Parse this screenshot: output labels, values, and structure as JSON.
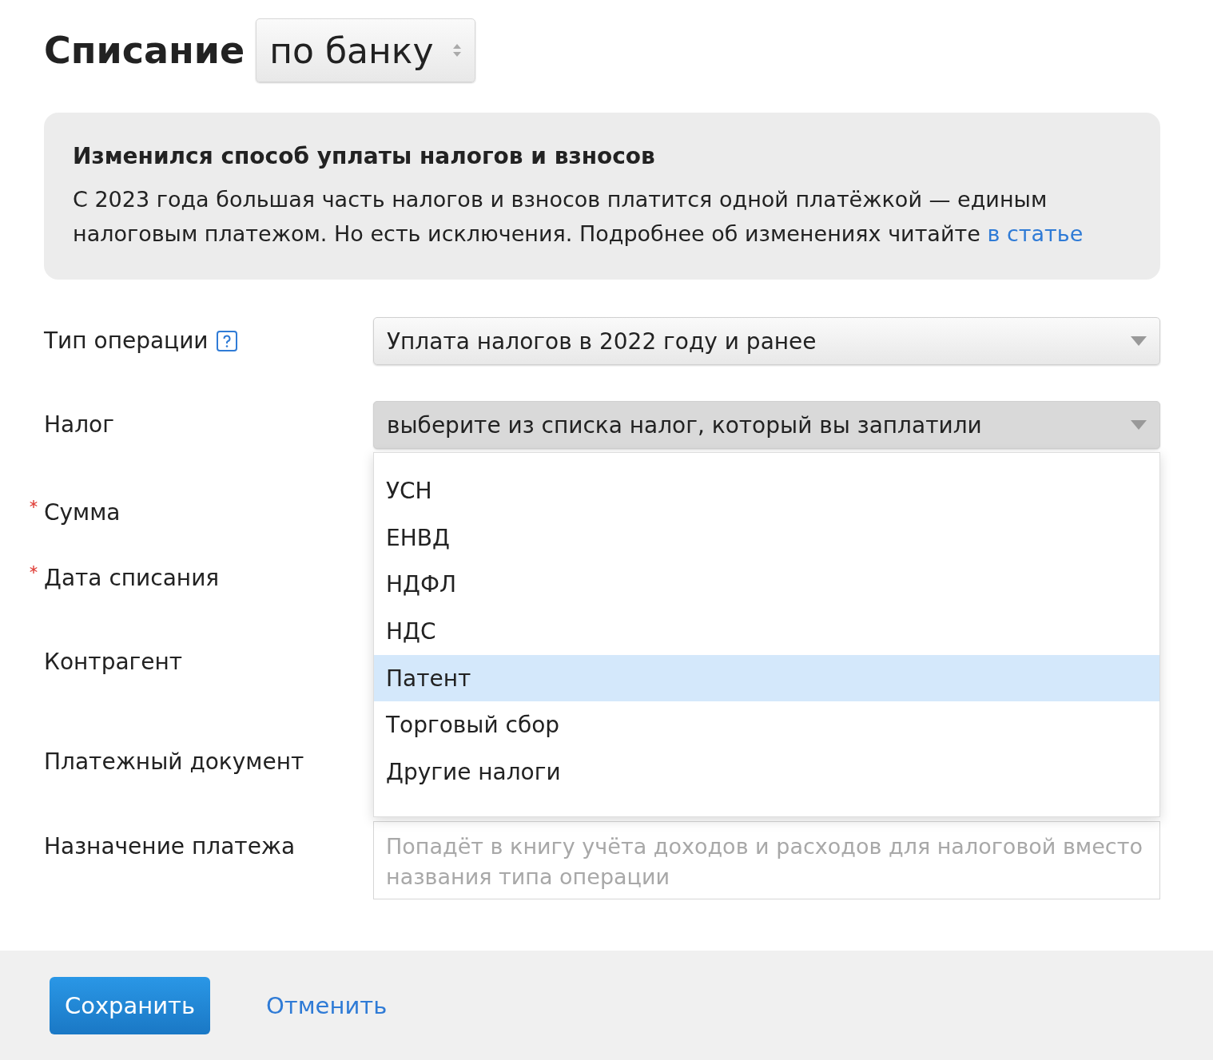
{
  "header": {
    "title": "Списание",
    "mode_select": {
      "value": "по банку"
    }
  },
  "notice": {
    "title": "Изменился способ уплаты налогов и взносов",
    "text": "С 2023 года большая часть налогов и взносов платится одной платёжкой — единым налоговым платежом. Но есть исключения. Подробнее об изменениях читайте",
    "link": "в статье"
  },
  "fields": [
    {
      "label": "Тип операции",
      "kind": "select",
      "required": false,
      "help": true,
      "value": "Уплата налогов в 2022 году и ранее",
      "open": false
    },
    {
      "label": "Налог",
      "kind": "select",
      "required": false,
      "help": false,
      "placeholder": "выберите из списка налог, который вы заплатили",
      "open": true,
      "options": [
        {
          "label": "УСН",
          "selected": false
        },
        {
          "label": "ЕНВД",
          "selected": false
        },
        {
          "label": "НДФЛ",
          "selected": false
        },
        {
          "label": "НДС",
          "selected": false
        },
        {
          "label": "Патент",
          "selected": true
        },
        {
          "label": "Торговый сбор",
          "selected": false
        },
        {
          "label": "Другие налоги",
          "selected": false
        }
      ]
    },
    {
      "label": "Сумма",
      "kind": "hidden",
      "required": true,
      "help": false
    },
    {
      "label": "Дата списания",
      "kind": "hidden",
      "required": true,
      "help": false
    },
    {
      "label": "Контрагент",
      "kind": "hidden",
      "required": false,
      "help": false
    },
    {
      "label": "Платежный документ",
      "kind": "hidden",
      "required": false,
      "help": false
    },
    {
      "label": "Назначение платежа",
      "kind": "textarea",
      "required": false,
      "help": false,
      "placeholder": "Попадёт в книгу учёта доходов и расходов для налоговой вместо названия типа операции"
    }
  ],
  "footer": {
    "save": "Сохранить",
    "cancel": "Отменить"
  }
}
